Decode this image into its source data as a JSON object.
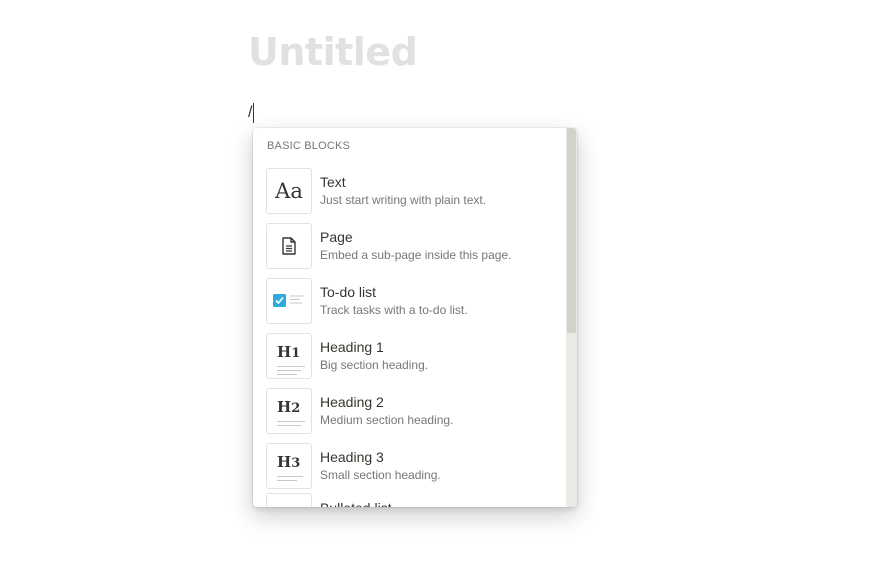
{
  "page": {
    "title_placeholder": "Untitled",
    "slash_text": "/"
  },
  "menu": {
    "section_header": "BASIC BLOCKS",
    "items": [
      {
        "title": "Text",
        "description": "Just start writing with plain text.",
        "icon": "text-aa-icon"
      },
      {
        "title": "Page",
        "description": "Embed a sub-page inside this page.",
        "icon": "page-document-icon"
      },
      {
        "title": "To-do list",
        "description": "Track tasks with a to-do list.",
        "icon": "todo-checkbox-icon"
      },
      {
        "title": "Heading 1",
        "description": "Big section heading.",
        "icon": "heading-1-icon",
        "badge": "H",
        "badge_num": "1"
      },
      {
        "title": "Heading 2",
        "description": "Medium section heading.",
        "icon": "heading-2-icon",
        "badge": "H",
        "badge_num": "2"
      },
      {
        "title": "Heading 3",
        "description": "Small section heading.",
        "icon": "heading-3-icon",
        "badge": "H",
        "badge_num": "3"
      },
      {
        "title": "Bulleted list",
        "description": "",
        "icon": "bulleted-list-icon"
      }
    ],
    "text_icon_glyph": "Aa"
  },
  "colors": {
    "checkbox_blue": "#2eaadc",
    "title_placeholder": "#e1e1e0"
  }
}
